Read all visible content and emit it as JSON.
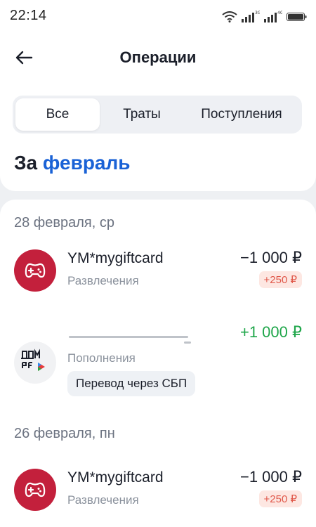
{
  "status_bar": {
    "time": "22:14",
    "net1": "3G",
    "net2": "4G",
    "icons": [
      "wifi-icon",
      "signal-icon",
      "signal-icon",
      "battery-icon"
    ]
  },
  "header": {
    "back_icon": "arrow-left-icon",
    "title": "Операции"
  },
  "tabs": [
    {
      "label": "Все",
      "active": true
    },
    {
      "label": "Траты",
      "active": false
    },
    {
      "label": "Поступления",
      "active": false
    }
  ],
  "period": {
    "prefix": "За",
    "month": "февраль"
  },
  "groups": [
    {
      "date": "28 февраля, ср",
      "transactions": [
        {
          "name": "YM*mygiftcard",
          "category": "Развлечения",
          "amount": "−1 000 ₽",
          "cashback": "+250 ₽",
          "icon": "gamepad-icon"
        },
        {
          "name": "",
          "category": "Пополнения",
          "amount": "+1 000 ₽",
          "tag": "Перевод через СБП",
          "icon": "dom-rf-logo"
        }
      ]
    },
    {
      "date": "26 февраля, пн",
      "transactions": [
        {
          "name": "YM*mygiftcard",
          "category": "Развлечения",
          "amount": "−1 000 ₽",
          "cashback": "+250 ₽",
          "icon": "gamepad-icon"
        }
      ]
    }
  ],
  "colors": {
    "accent": "#1a62d6",
    "income": "#1fa64a",
    "cashback_text": "#e0584a",
    "cashback_bg": "#fde7e2",
    "game_avatar": "#c3203c"
  }
}
